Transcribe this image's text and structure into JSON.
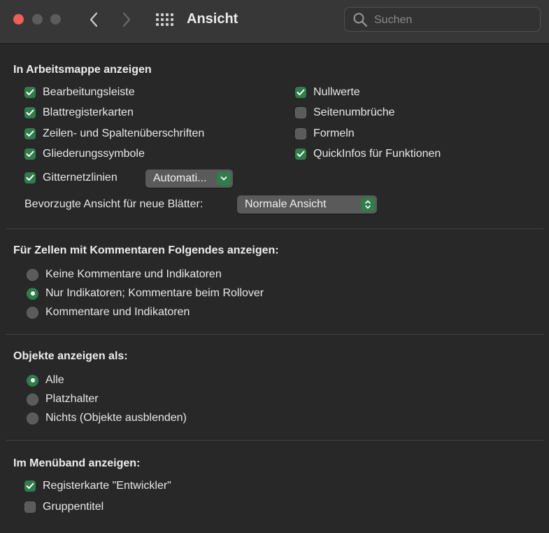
{
  "window": {
    "title": "Ansicht",
    "search_placeholder": "Suchen"
  },
  "workbook": {
    "title": "In Arbeitsmappe anzeigen",
    "left": [
      {
        "label": "Bearbeitungsleiste",
        "checked": true
      },
      {
        "label": "Blattregisterkarten",
        "checked": true
      },
      {
        "label": "Zeilen- und Spaltenüberschriften",
        "checked": true
      },
      {
        "label": "Gliederungssymbole",
        "checked": true
      }
    ],
    "right": [
      {
        "label": "Nullwerte",
        "checked": true
      },
      {
        "label": "Seitenumbrüche",
        "checked": false
      },
      {
        "label": "Formeln",
        "checked": false
      },
      {
        "label": "QuickInfos für Funktionen",
        "checked": true
      }
    ],
    "gridlines": {
      "label": "Gitternetzlinien",
      "checked": true,
      "color_value": "Automati..."
    },
    "preferred_view": {
      "label": "Bevorzugte Ansicht für neue Blätter:",
      "value": "Normale Ansicht"
    }
  },
  "comments": {
    "title": "Für Zellen mit Kommentaren Folgendes anzeigen:",
    "options": [
      {
        "label": "Keine Kommentare und Indikatoren",
        "selected": false
      },
      {
        "label": "Nur Indikatoren; Kommentare beim Rollover",
        "selected": true
      },
      {
        "label": "Kommentare und Indikatoren",
        "selected": false
      }
    ]
  },
  "objects": {
    "title": "Objekte anzeigen als:",
    "options": [
      {
        "label": "Alle",
        "selected": true
      },
      {
        "label": "Platzhalter",
        "selected": false
      },
      {
        "label": "Nichts (Objekte ausblenden)",
        "selected": false
      }
    ]
  },
  "ribbon": {
    "title": "Im Menüband anzeigen:",
    "items": [
      {
        "label": "Registerkarte \"Entwickler\"",
        "checked": true
      },
      {
        "label": "Gruppentitel",
        "checked": false
      }
    ]
  },
  "colors": {
    "accent": "#2e7d4a",
    "close": "#ed5f57"
  }
}
